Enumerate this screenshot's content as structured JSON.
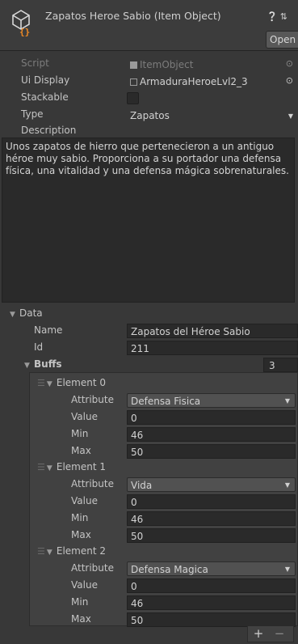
{
  "header": {
    "title": "Zapatos Heroe Sabio (Item Object)",
    "help_icon": "help-icon",
    "settings_icon": "preset-icon",
    "open_label": "Open"
  },
  "fields": {
    "script": {
      "label": "Script",
      "value": "ItemObject"
    },
    "ui_display": {
      "label": "Ui Display",
      "value": "ArmaduraHeroeLvl2_3"
    },
    "stackable": {
      "label": "Stackable",
      "checked": false
    },
    "type": {
      "label": "Type",
      "value": "Zapatos"
    },
    "description": {
      "label": "Description",
      "value": "Unos zapatos de hierro que pertenecieron a un antiguo héroe muy sabio. Proporciona a su portador una defensa física, una vitalidad y una defensa mágica sobrenaturales."
    }
  },
  "data": {
    "label": "Data",
    "name_label": "Name",
    "name_value": "Zapatos del Héroe Sabio",
    "id_label": "Id",
    "id_value": "211",
    "buffs_label": "Buffs",
    "buffs_count": "3",
    "elements": [
      {
        "label": "Element 0",
        "attribute_label": "Attribute",
        "attribute": "Defensa Fisica",
        "value_label": "Value",
        "value": "0",
        "min_label": "Min",
        "min": "46",
        "max_label": "Max",
        "max": "50"
      },
      {
        "label": "Element 1",
        "attribute_label": "Attribute",
        "attribute": "Vida",
        "value_label": "Value",
        "value": "0",
        "min_label": "Min",
        "min": "46",
        "max_label": "Max",
        "max": "50"
      },
      {
        "label": "Element 2",
        "attribute_label": "Attribute",
        "attribute": "Defensa Magica",
        "value_label": "Value",
        "value": "0",
        "min_label": "Min",
        "min": "46",
        "max_label": "Max",
        "max": "50"
      }
    ],
    "add_label": "+",
    "remove_label": "−"
  }
}
